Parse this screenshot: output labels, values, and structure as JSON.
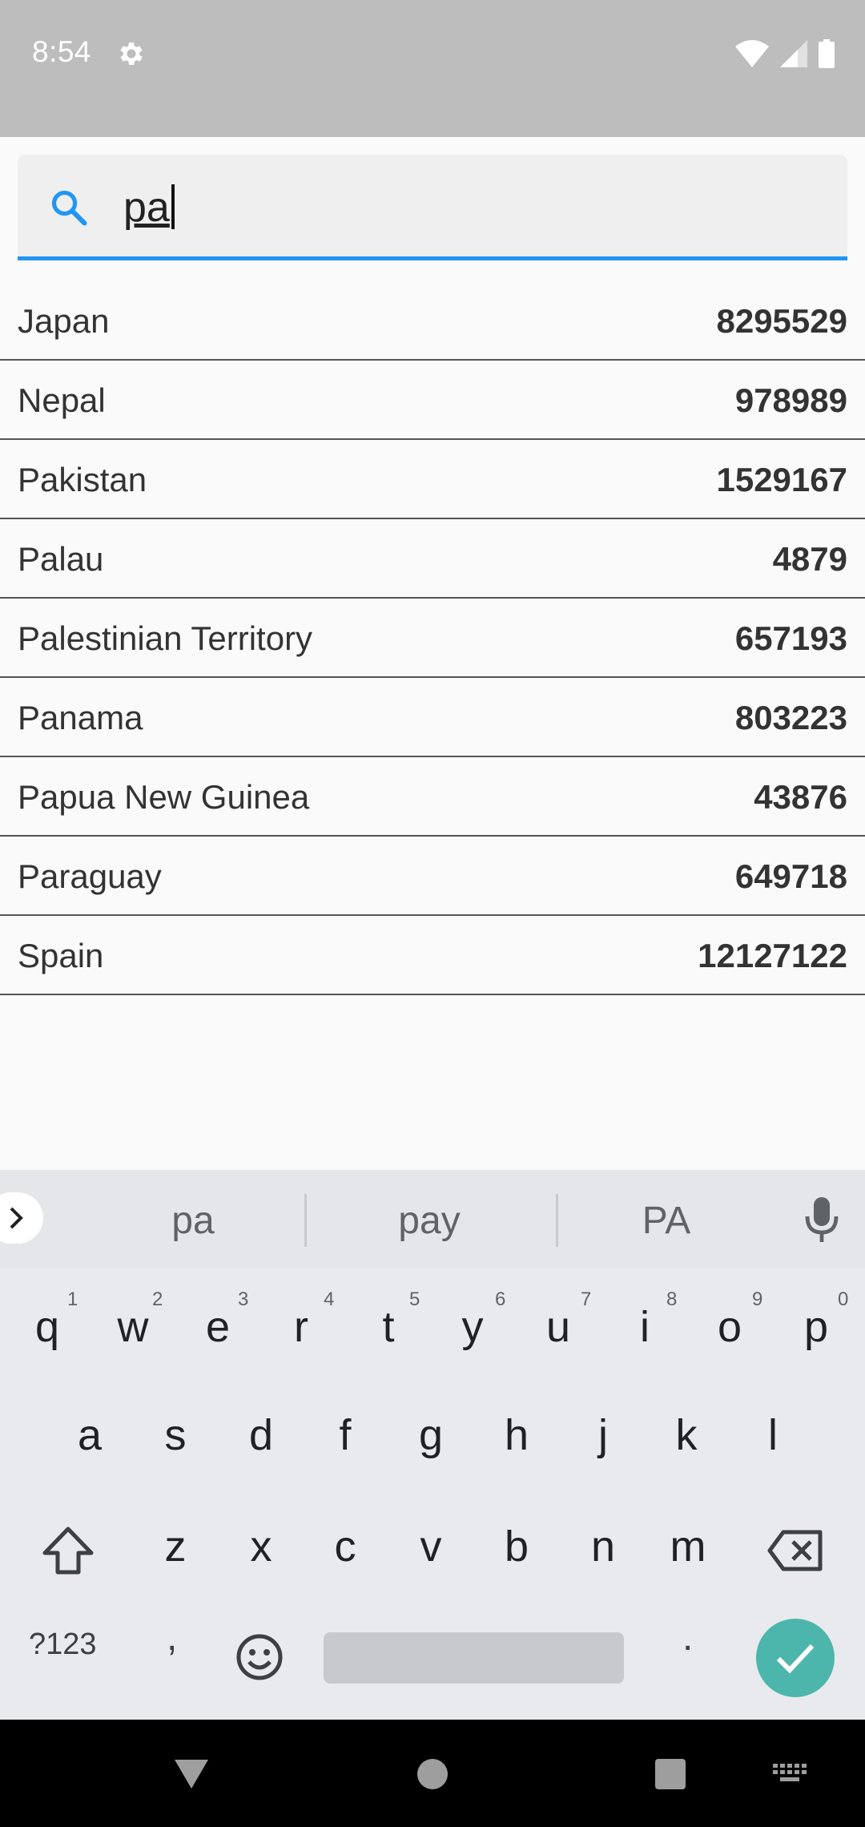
{
  "status": {
    "time": "8:54"
  },
  "search": {
    "query": "pa"
  },
  "countries": [
    {
      "name": "Japan",
      "value": "8295529"
    },
    {
      "name": "Nepal",
      "value": "978989"
    },
    {
      "name": "Pakistan",
      "value": "1529167"
    },
    {
      "name": "Palau",
      "value": "4879"
    },
    {
      "name": "Palestinian Territory",
      "value": "657193"
    },
    {
      "name": "Panama",
      "value": "803223"
    },
    {
      "name": "Papua New Guinea",
      "value": "43876"
    },
    {
      "name": "Paraguay",
      "value": "649718"
    },
    {
      "name": "Spain",
      "value": "12127122"
    }
  ],
  "keyboard": {
    "suggestions": [
      "pa",
      "pay",
      "PA"
    ],
    "row1": [
      "q",
      "w",
      "e",
      "r",
      "t",
      "y",
      "u",
      "i",
      "o",
      "p"
    ],
    "row1_hints": [
      "1",
      "2",
      "3",
      "4",
      "5",
      "6",
      "7",
      "8",
      "9",
      "0"
    ],
    "row2": [
      "a",
      "s",
      "d",
      "f",
      "g",
      "h",
      "j",
      "k",
      "l"
    ],
    "row3": [
      "z",
      "x",
      "c",
      "v",
      "b",
      "n",
      "m"
    ],
    "symbols_label": "?123",
    "comma": ",",
    "period": "."
  },
  "colors": {
    "accent": "#2196f3",
    "enter": "#4db6ac"
  }
}
